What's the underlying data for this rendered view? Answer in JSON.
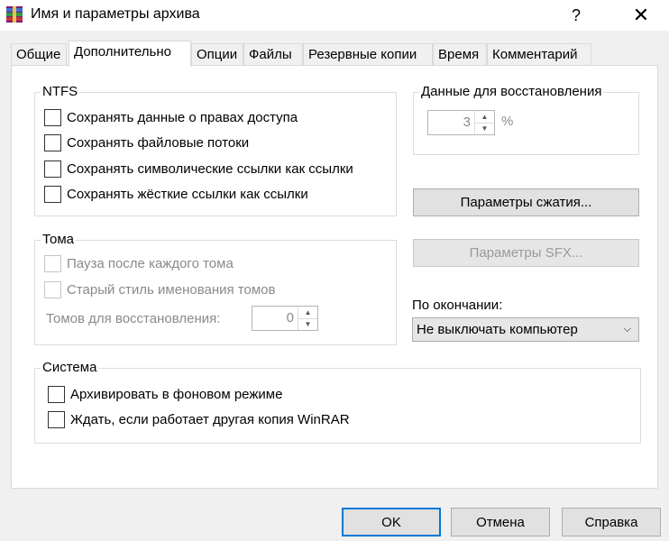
{
  "window": {
    "title": "Имя и параметры архива",
    "help": "?",
    "close": "✕"
  },
  "tabs": [
    {
      "label": "Общие",
      "active": false
    },
    {
      "label": "Дополнительно",
      "active": true
    },
    {
      "label": "Опции",
      "active": false
    },
    {
      "label": "Файлы",
      "active": false
    },
    {
      "label": "Резервные копии",
      "active": false
    },
    {
      "label": "Время",
      "active": false
    },
    {
      "label": "Комментарий",
      "active": false
    }
  ],
  "ntfs": {
    "title": "NTFS",
    "options": [
      {
        "label": "Сохранять данные о правах доступа",
        "checked": false
      },
      {
        "label": "Сохранять файловые потоки",
        "checked": false
      },
      {
        "label": "Сохранять символические ссылки как ссылки",
        "checked": false
      },
      {
        "label": "Сохранять жёсткие ссылки как ссылки",
        "checked": false
      }
    ]
  },
  "recovery": {
    "title": "Данные для восстановления",
    "value": "3",
    "unit": "%"
  },
  "volumes": {
    "title": "Тома",
    "pause_label": "Пауза после каждого тома",
    "old_naming_label": "Старый стиль именования томов",
    "recovery_volumes_label": "Томов для восстановления:",
    "recovery_volumes_value": "0"
  },
  "buttons": {
    "compression": "Параметры сжатия...",
    "sfx": "Параметры SFX...",
    "ok": "OK",
    "cancel": "Отмена",
    "help": "Справка"
  },
  "on_finish": {
    "label": "По окончании:",
    "value": "Не выключать компьютер"
  },
  "system": {
    "title": "Система",
    "options": [
      {
        "label": "Архивировать в фоновом режиме",
        "checked": false
      },
      {
        "label": "Ждать, если работает другая копия WinRAR",
        "checked": false
      }
    ]
  }
}
